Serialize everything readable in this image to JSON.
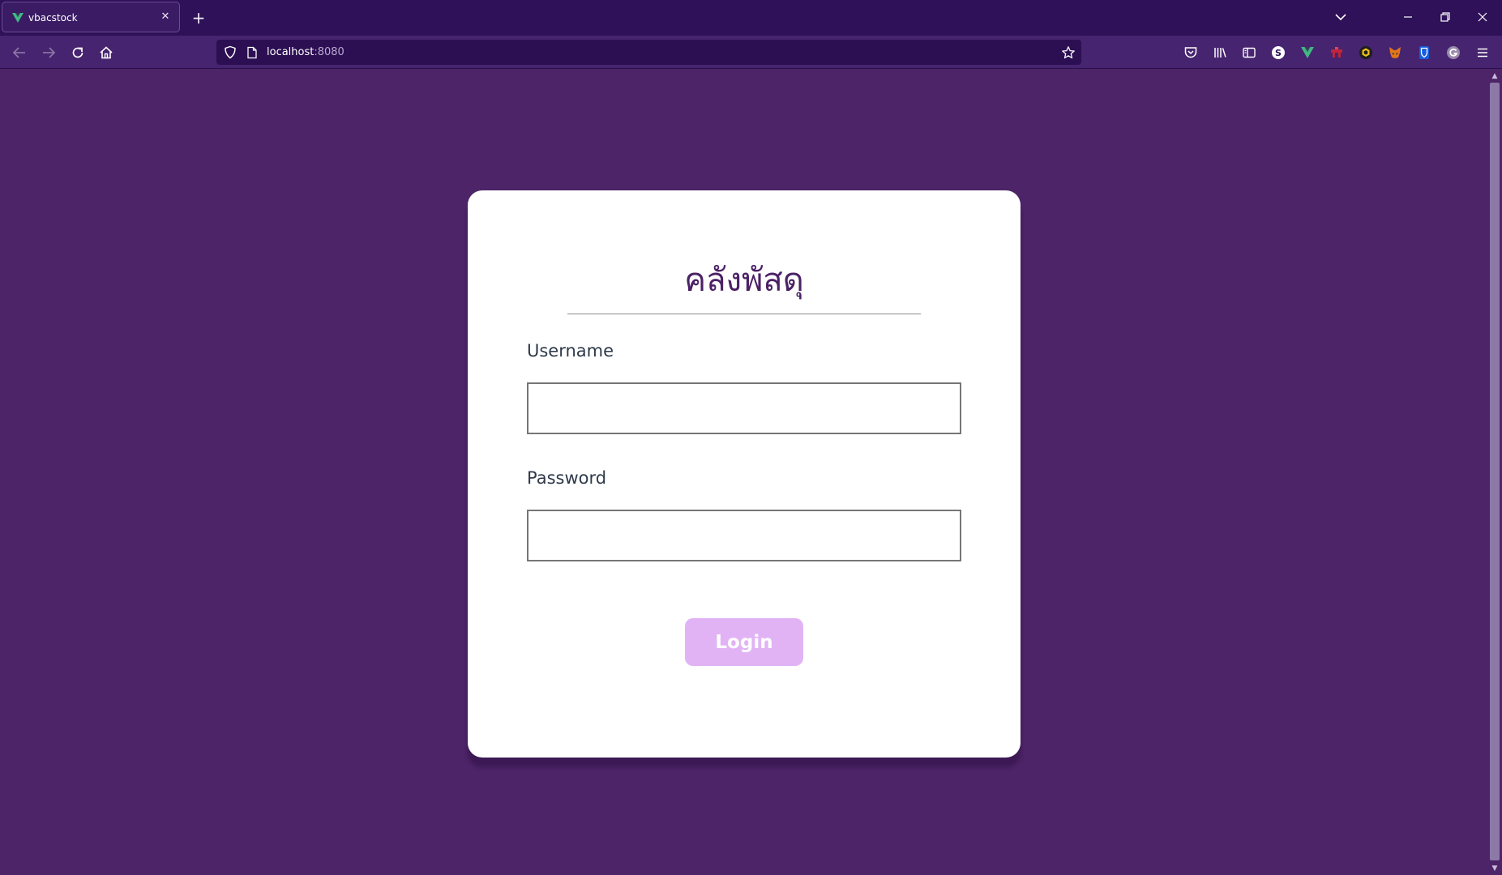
{
  "browser": {
    "tab": {
      "title": "vbacstock",
      "favicon_icon": "vue-logo-icon",
      "close_glyph": "✕"
    },
    "new_tab_glyph": "+",
    "url": {
      "host": "localhost",
      "port": ":8080"
    },
    "toolbar_icons": [
      "pocket-icon",
      "library-icon",
      "sidebar-icon",
      "extension-s-icon",
      "vue-devtools-icon",
      "extension-red-icon",
      "extension-cube-icon",
      "metamask-fox-icon",
      "bitwarden-shield-icon",
      "grammarly-icon",
      "menu-icon"
    ],
    "scroll_up_glyph": "▲",
    "scroll_down_glyph": "▼"
  },
  "colors": {
    "page_background": "#4d2468",
    "tabstrip_background": "#2e1158",
    "navbar_background": "#46246f",
    "title_color": "#4b2166",
    "login_button": "#e1b3f5"
  },
  "login": {
    "title": "คลังพัสดุ",
    "username_label": "Username",
    "username_value": "",
    "password_label": "Password",
    "password_value": "",
    "button_label": "Login"
  }
}
